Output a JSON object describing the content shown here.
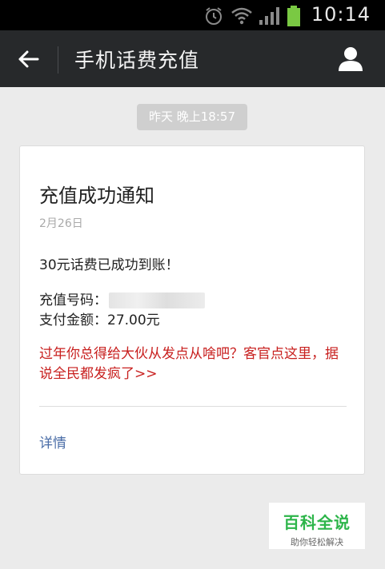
{
  "status_bar": {
    "time": "10:14",
    "icons": [
      "alarm-icon",
      "wifi-icon",
      "signal-icon",
      "battery-icon"
    ],
    "battery_color": "#7ac943"
  },
  "title_bar": {
    "title": "手机话费充值",
    "back_icon": "arrow-left-icon",
    "profile_icon": "person-icon",
    "background": "#27292b"
  },
  "chat": {
    "timestamp": "昨天 晚上18:57"
  },
  "card": {
    "title": "充值成功通知",
    "date": "2月26日",
    "message": "30元话费已成功到账！",
    "phone_label": "充值号码：",
    "amount_label": "支付金额：",
    "amount_value": "27.00元",
    "promo": "过年你总得给大伙从发点从啥吧？客官点这里，据说全民都发疯了>>",
    "details_label": "详情",
    "promo_color": "#c8201f",
    "link_color": "#4a6da7"
  },
  "watermark": {
    "title": "百科全说",
    "subtitle": "助你轻松解决",
    "color": "#2db54a"
  }
}
